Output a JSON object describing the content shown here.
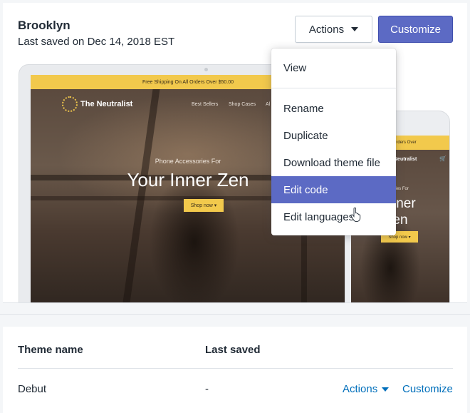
{
  "current_theme": {
    "name": "Brooklyn",
    "last_saved": "Last saved on Dec 14, 2018 EST",
    "actions_label": "Actions",
    "customize_label": "Customize"
  },
  "preview": {
    "promo": "Free Shipping On All Orders Over $50.00",
    "logo": "The Neutralist",
    "nav": [
      "Best Sellers",
      "Shop Cases",
      "Al"
    ],
    "hero_subtitle": "Phone Accessories For",
    "hero_title": "Your Inner Zen",
    "shop_button": "Shop now ▾",
    "phone_promo": "ll All Orders Over",
    "phone_logo": "Neutralist",
    "phone_subtitle": "ories For",
    "phone_title": "Inner\nen",
    "phone_button": "Shop now ▾"
  },
  "menu": {
    "items": [
      {
        "label": "View"
      },
      {
        "label": "Rename"
      },
      {
        "label": "Duplicate"
      },
      {
        "label": "Download theme file"
      },
      {
        "label": "Edit code",
        "state": "highlighted"
      },
      {
        "label": "Edit languages"
      }
    ]
  },
  "library": {
    "headers": {
      "name": "Theme name",
      "saved": "Last saved"
    },
    "rows": [
      {
        "name": "Debut",
        "saved": "-",
        "actions_label": "Actions",
        "customize_label": "Customize"
      }
    ]
  },
  "colors": {
    "primary": "#5c6ac4",
    "link": "#006fbb",
    "promo_yellow": "#f2c94c"
  }
}
